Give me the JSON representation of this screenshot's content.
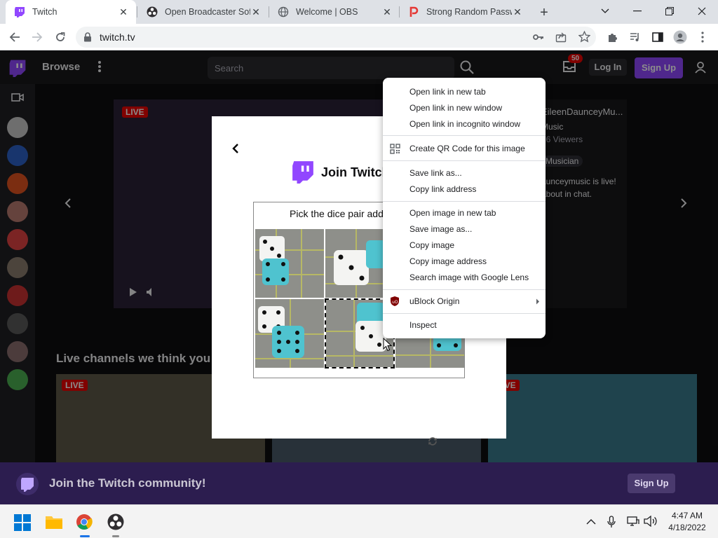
{
  "browser": {
    "tabs": [
      {
        "title": "Twitch",
        "active": true
      },
      {
        "title": "Open Broadcaster Soft",
        "active": false
      },
      {
        "title": "Welcome | OBS",
        "active": false
      },
      {
        "title": "Strong Random Passw",
        "active": false
      }
    ],
    "url": "twitch.tv"
  },
  "twitch": {
    "browse": "Browse",
    "search_placeholder": "Search",
    "notif_count": "50",
    "login": "Log In",
    "signup": "Sign Up",
    "featured": {
      "live": "LIVE",
      "channel": "EileenDaunceyMu...",
      "category": "Music",
      "viewers": "16 Viewers",
      "tag": "Musician",
      "description": "aunceymusic is live! about in chat."
    },
    "section_title": "Live channels we think you",
    "card_live": "LIVE",
    "bottom": {
      "text": "Join the Twitch community!",
      "signup": "Sign Up"
    },
    "modal": {
      "title": "Join Twitch",
      "captcha_prompt": "Pick the dice pair add"
    }
  },
  "context_menu": {
    "items": [
      "Open link in new tab",
      "Open link in new window",
      "Open link in incognito window",
      "Create QR Code for this image",
      "Save link as...",
      "Copy link address",
      "Open image in new tab",
      "Save image as...",
      "Copy image",
      "Copy image address",
      "Search image with Google Lens",
      "uBlock Origin",
      "Inspect"
    ]
  },
  "taskbar": {
    "time": "4:47 AM",
    "date": "4/18/2022"
  },
  "colors": {
    "twitch_purple": "#9147ff",
    "dice_teal": "#4fc3cf",
    "chrome_tabstrip": "#dee1e6"
  }
}
